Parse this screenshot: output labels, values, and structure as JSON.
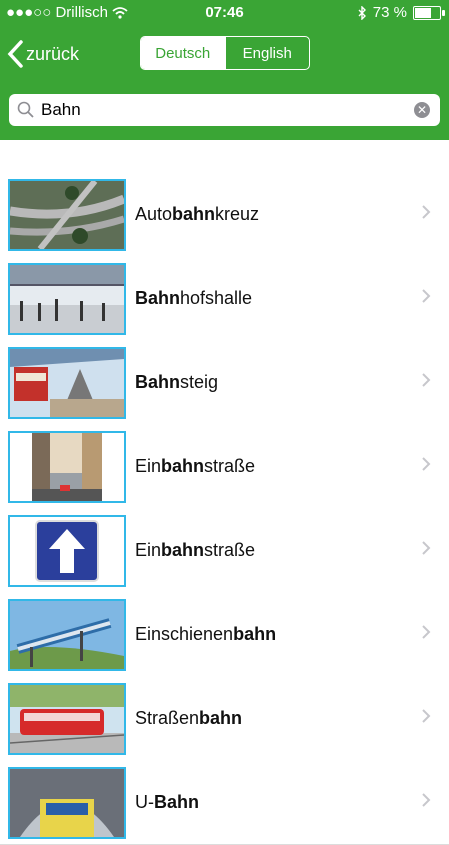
{
  "status": {
    "carrier": "●●●○○ Drillisch",
    "time": "07:46",
    "battery": "73 %",
    "battery_level": 0.73
  },
  "nav": {
    "back_label": "zurück",
    "seg_left": "Deutsch",
    "seg_right": "English"
  },
  "search": {
    "value": "Bahn"
  },
  "rows": [
    {
      "pre": "Auto",
      "bold": "bahn",
      "post": "kreuz",
      "thumb": "highway-interchange"
    },
    {
      "pre": "",
      "bold": "Bahn",
      "post": "hofshalle",
      "thumb": "station-hall"
    },
    {
      "pre": "",
      "bold": "Bahn",
      "post": "steig",
      "thumb": "platform"
    },
    {
      "pre": "Ein",
      "bold": "bahn",
      "post": "straße",
      "thumb": "city-street"
    },
    {
      "pre": "Ein",
      "bold": "bahn",
      "post": "straße",
      "thumb": "one-way-sign"
    },
    {
      "pre": "Einschienen",
      "bold": "bahn",
      "post": "",
      "thumb": "monorail"
    },
    {
      "pre": "Straßen",
      "bold": "bahn",
      "post": "",
      "thumb": "tram"
    },
    {
      "pre": "U-",
      "bold": "Bahn",
      "post": "",
      "thumb": "subway"
    }
  ],
  "colors": {
    "accent": "#3aa535",
    "thumb_border": "#31b8e8"
  }
}
